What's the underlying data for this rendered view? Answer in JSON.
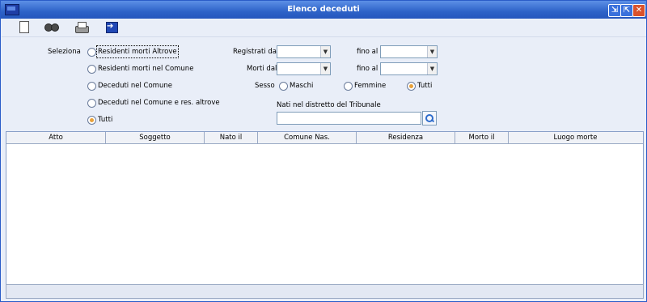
{
  "window": {
    "title": "Elenco deceduti",
    "min": "⇲",
    "max": "⇱",
    "close": "✕"
  },
  "toolbar": {
    "items": [
      "new-document-icon",
      "binoculars-icon",
      "printer-icon",
      "exit-icon"
    ]
  },
  "filters": {
    "seleziona_label": "Seleziona",
    "options": [
      "Residenti morti Altrove",
      "Residenti morti nel Comune",
      "Deceduti nel Comune",
      "Deceduti nel Comune e res. altrove",
      "Tutti"
    ],
    "selected_option": "Tutti",
    "registrati_dal_label": "Registrati dal",
    "fino_al_label_1": "fino al",
    "morti_dal_label": "Morti dal",
    "fino_al_label_2": "fino al",
    "registrati_dal_value": "",
    "registrati_fino_value": "",
    "morti_dal_value": "",
    "morti_fino_value": "",
    "sesso_label": "Sesso",
    "sesso_options": [
      "Maschi",
      "Femmine",
      "Tutti"
    ],
    "sesso_selected": "Tutti",
    "nati_label": "Nati nel distretto del Tribunale",
    "nati_value": ""
  },
  "table": {
    "columns": [
      "Atto",
      "Soggetto",
      "Nato il",
      "Comune Nas.",
      "Residenza",
      "Morto il",
      "Luogo morte"
    ],
    "rows": []
  },
  "status": {
    "text": ""
  }
}
